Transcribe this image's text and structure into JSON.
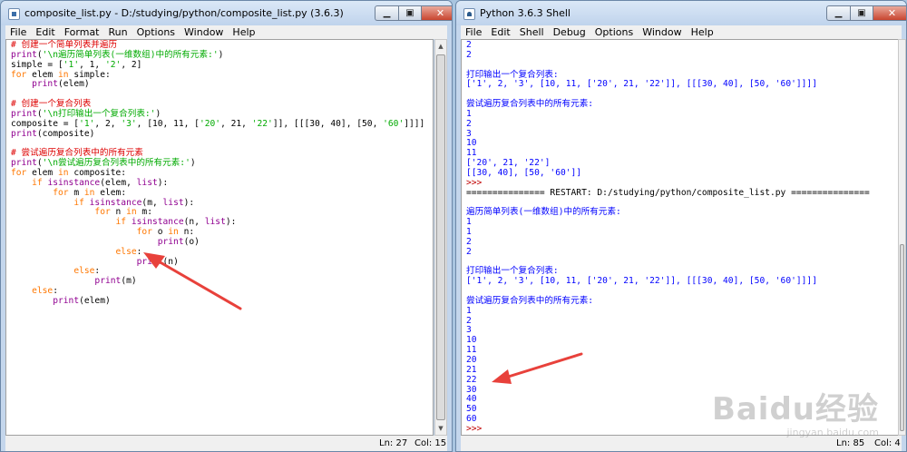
{
  "editor_window": {
    "title": "composite_list.py - D:/studying/python/composite_list.py (3.6.3)",
    "menus": [
      "File",
      "Edit",
      "Format",
      "Run",
      "Options",
      "Window",
      "Help"
    ],
    "caption_buttons": {
      "minimize": "▁",
      "maximize": "▣",
      "close": "✕"
    },
    "code_lines": [
      [
        {
          "t": "# 创建一个简单列表并遍历",
          "c": "c"
        }
      ],
      [
        {
          "t": "print",
          "c": "b"
        },
        {
          "t": "(",
          "c": "d"
        },
        {
          "t": "'\\n遍历简单列表(一维数组)中的所有元素:'",
          "c": "s"
        },
        {
          "t": ")",
          "c": "d"
        }
      ],
      [
        {
          "t": "simple = [",
          "c": "d"
        },
        {
          "t": "'1'",
          "c": "s"
        },
        {
          "t": ", 1, ",
          "c": "d"
        },
        {
          "t": "'2'",
          "c": "s"
        },
        {
          "t": ", 2]",
          "c": "d"
        }
      ],
      [
        {
          "t": "for",
          "c": "k"
        },
        {
          "t": " elem ",
          "c": "d"
        },
        {
          "t": "in",
          "c": "k"
        },
        {
          "t": " simple:",
          "c": "d"
        }
      ],
      [
        {
          "t": "    ",
          "c": "d"
        },
        {
          "t": "print",
          "c": "b"
        },
        {
          "t": "(elem)",
          "c": "d"
        }
      ],
      [],
      [
        {
          "t": "# 创建一个复合列表",
          "c": "c"
        }
      ],
      [
        {
          "t": "print",
          "c": "b"
        },
        {
          "t": "(",
          "c": "d"
        },
        {
          "t": "'\\n打印输出一个复合列表:'",
          "c": "s"
        },
        {
          "t": ")",
          "c": "d"
        }
      ],
      [
        {
          "t": "composite = [",
          "c": "d"
        },
        {
          "t": "'1'",
          "c": "s"
        },
        {
          "t": ", 2, ",
          "c": "d"
        },
        {
          "t": "'3'",
          "c": "s"
        },
        {
          "t": ", [10, 11, [",
          "c": "d"
        },
        {
          "t": "'20'",
          "c": "s"
        },
        {
          "t": ", 21, ",
          "c": "d"
        },
        {
          "t": "'22'",
          "c": "s"
        },
        {
          "t": "]], [[[30, 40], [50, ",
          "c": "d"
        },
        {
          "t": "'60'",
          "c": "s"
        },
        {
          "t": "]]]]",
          "c": "d"
        }
      ],
      [
        {
          "t": "print",
          "c": "b"
        },
        {
          "t": "(composite)",
          "c": "d"
        }
      ],
      [],
      [
        {
          "t": "# 尝试遍历复合列表中的所有元素",
          "c": "c"
        }
      ],
      [
        {
          "t": "print",
          "c": "b"
        },
        {
          "t": "(",
          "c": "d"
        },
        {
          "t": "'\\n尝试遍历复合列表中的所有元素:'",
          "c": "s"
        },
        {
          "t": ")",
          "c": "d"
        }
      ],
      [
        {
          "t": "for",
          "c": "k"
        },
        {
          "t": " elem ",
          "c": "d"
        },
        {
          "t": "in",
          "c": "k"
        },
        {
          "t": " composite:",
          "c": "d"
        }
      ],
      [
        {
          "t": "    ",
          "c": "d"
        },
        {
          "t": "if",
          "c": "k"
        },
        {
          "t": " ",
          "c": "d"
        },
        {
          "t": "isinstance",
          "c": "b"
        },
        {
          "t": "(elem, ",
          "c": "d"
        },
        {
          "t": "list",
          "c": "b"
        },
        {
          "t": "):",
          "c": "d"
        }
      ],
      [
        {
          "t": "        ",
          "c": "d"
        },
        {
          "t": "for",
          "c": "k"
        },
        {
          "t": " m ",
          "c": "d"
        },
        {
          "t": "in",
          "c": "k"
        },
        {
          "t": " elem:",
          "c": "d"
        }
      ],
      [
        {
          "t": "            ",
          "c": "d"
        },
        {
          "t": "if",
          "c": "k"
        },
        {
          "t": " ",
          "c": "d"
        },
        {
          "t": "isinstance",
          "c": "b"
        },
        {
          "t": "(m, ",
          "c": "d"
        },
        {
          "t": "list",
          "c": "b"
        },
        {
          "t": "):",
          "c": "d"
        }
      ],
      [
        {
          "t": "                ",
          "c": "d"
        },
        {
          "t": "for",
          "c": "k"
        },
        {
          "t": " n ",
          "c": "d"
        },
        {
          "t": "in",
          "c": "k"
        },
        {
          "t": " m:",
          "c": "d"
        }
      ],
      [
        {
          "t": "                    ",
          "c": "d"
        },
        {
          "t": "if",
          "c": "k"
        },
        {
          "t": " ",
          "c": "d"
        },
        {
          "t": "isinstance",
          "c": "b"
        },
        {
          "t": "(n, ",
          "c": "d"
        },
        {
          "t": "list",
          "c": "b"
        },
        {
          "t": "):",
          "c": "d"
        }
      ],
      [
        {
          "t": "                        ",
          "c": "d"
        },
        {
          "t": "for",
          "c": "k"
        },
        {
          "t": " o ",
          "c": "d"
        },
        {
          "t": "in",
          "c": "k"
        },
        {
          "t": " n:",
          "c": "d"
        }
      ],
      [
        {
          "t": "                            ",
          "c": "d"
        },
        {
          "t": "print",
          "c": "b"
        },
        {
          "t": "(o)",
          "c": "d"
        }
      ],
      [
        {
          "t": "                    ",
          "c": "d"
        },
        {
          "t": "else",
          "c": "k"
        },
        {
          "t": ":",
          "c": "d"
        }
      ],
      [
        {
          "t": "                        ",
          "c": "d"
        },
        {
          "t": "print",
          "c": "b"
        },
        {
          "t": "(n)",
          "c": "d"
        }
      ],
      [
        {
          "t": "            ",
          "c": "d"
        },
        {
          "t": "else",
          "c": "k"
        },
        {
          "t": ":",
          "c": "d"
        }
      ],
      [
        {
          "t": "                ",
          "c": "d"
        },
        {
          "t": "print",
          "c": "b"
        },
        {
          "t": "(m)",
          "c": "d"
        }
      ],
      [
        {
          "t": "    ",
          "c": "d"
        },
        {
          "t": "else",
          "c": "k"
        },
        {
          "t": ":",
          "c": "d"
        }
      ],
      [
        {
          "t": "        ",
          "c": "d"
        },
        {
          "t": "print",
          "c": "b"
        },
        {
          "t": "(elem)",
          "c": "d"
        }
      ]
    ],
    "status": {
      "ln": "Ln: 27",
      "col": "Col: 15"
    }
  },
  "shell_window": {
    "title": "Python 3.6.3 Shell",
    "menus": [
      "File",
      "Edit",
      "Shell",
      "Debug",
      "Options",
      "Window",
      "Help"
    ],
    "caption_buttons": {
      "minimize": "▁",
      "maximize": "▣",
      "close": "✕"
    },
    "output_lines": [
      [
        {
          "t": "2",
          "c": "o"
        }
      ],
      [
        {
          "t": "2",
          "c": "o"
        }
      ],
      [],
      [
        {
          "t": "打印输出一个复合列表:",
          "c": "o"
        }
      ],
      [
        {
          "t": "['1', 2, '3', [10, 11, ['20', 21, '22']], [[[30, 40], [50, '60']]]]",
          "c": "o"
        }
      ],
      [],
      [
        {
          "t": "尝试遍历复合列表中的所有元素:",
          "c": "o"
        }
      ],
      [
        {
          "t": "1",
          "c": "o"
        }
      ],
      [
        {
          "t": "2",
          "c": "o"
        }
      ],
      [
        {
          "t": "3",
          "c": "o"
        }
      ],
      [
        {
          "t": "10",
          "c": "o"
        }
      ],
      [
        {
          "t": "11",
          "c": "o"
        }
      ],
      [
        {
          "t": "['20', 21, '22']",
          "c": "o"
        }
      ],
      [
        {
          "t": "[[30, 40], [50, '60']]",
          "c": "o"
        }
      ],
      [
        {
          "t": ">>>",
          "c": "p"
        }
      ],
      [
        {
          "t": "=============== RESTART: D:/studying/python/composite_list.py ===============",
          "c": "d"
        }
      ],
      [],
      [
        {
          "t": "遍历简单列表(一维数组)中的所有元素:",
          "c": "o"
        }
      ],
      [
        {
          "t": "1",
          "c": "o"
        }
      ],
      [
        {
          "t": "1",
          "c": "o"
        }
      ],
      [
        {
          "t": "2",
          "c": "o"
        }
      ],
      [
        {
          "t": "2",
          "c": "o"
        }
      ],
      [],
      [
        {
          "t": "打印输出一个复合列表:",
          "c": "o"
        }
      ],
      [
        {
          "t": "['1', 2, '3', [10, 11, ['20', 21, '22']], [[[30, 40], [50, '60']]]]",
          "c": "o"
        }
      ],
      [],
      [
        {
          "t": "尝试遍历复合列表中的所有元素:",
          "c": "o"
        }
      ],
      [
        {
          "t": "1",
          "c": "o"
        }
      ],
      [
        {
          "t": "2",
          "c": "o"
        }
      ],
      [
        {
          "t": "3",
          "c": "o"
        }
      ],
      [
        {
          "t": "10",
          "c": "o"
        }
      ],
      [
        {
          "t": "11",
          "c": "o"
        }
      ],
      [
        {
          "t": "20",
          "c": "o"
        }
      ],
      [
        {
          "t": "21",
          "c": "o"
        }
      ],
      [
        {
          "t": "22",
          "c": "o"
        }
      ],
      [
        {
          "t": "30",
          "c": "o"
        }
      ],
      [
        {
          "t": "40",
          "c": "o"
        }
      ],
      [
        {
          "t": "50",
          "c": "o"
        }
      ],
      [
        {
          "t": "60",
          "c": "o"
        }
      ],
      [
        {
          "t": ">>>",
          "c": "p"
        }
      ]
    ],
    "status": {
      "ln": "Ln: 85",
      "col": "Col: 4"
    }
  },
  "watermark": {
    "brand": "Baidu经验",
    "url": "jingyan.baidu.com"
  },
  "colors": {
    "keyword": "#ff7700",
    "comment": "#dd0000",
    "string": "#00aa00",
    "builtin": "#900090",
    "output": "#0000ff",
    "prompt": "#c00000",
    "annotation_arrow": "#e8413b"
  }
}
